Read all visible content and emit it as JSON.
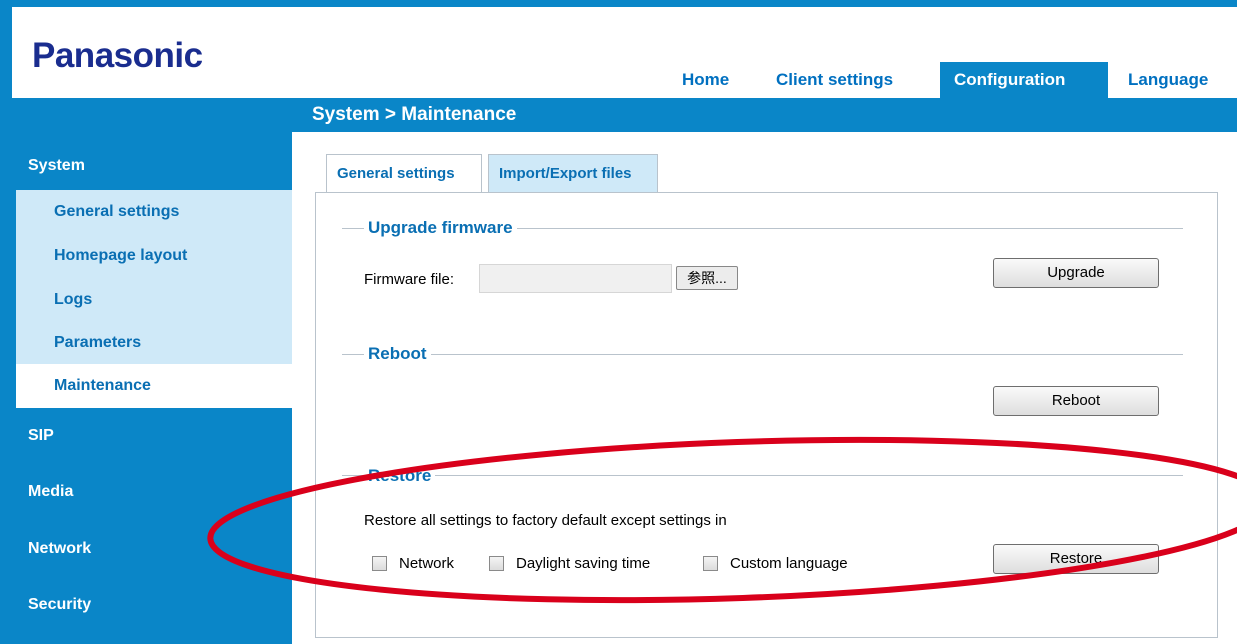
{
  "brand": {
    "logo_text": "Panasonic"
  },
  "top_nav": {
    "items": [
      {
        "label": "Home"
      },
      {
        "label": "Client settings"
      },
      {
        "label": "Configuration"
      },
      {
        "label": "Language"
      }
    ],
    "active": "Configuration"
  },
  "breadcrumb": "System  >  Maintenance",
  "sidebar": {
    "system_label": "System",
    "sub_items": [
      {
        "label": "General settings"
      },
      {
        "label": "Homepage layout"
      },
      {
        "label": "Logs"
      },
      {
        "label": "Parameters"
      },
      {
        "label": "Maintenance"
      }
    ],
    "selected_sub": "Maintenance",
    "main_items": [
      {
        "label": "SIP"
      },
      {
        "label": "Media"
      },
      {
        "label": "Network"
      },
      {
        "label": "Security"
      }
    ]
  },
  "tabs": [
    {
      "label": "General settings"
    },
    {
      "label": "Import/Export files"
    }
  ],
  "upgrade": {
    "section_title": "Upgrade firmware",
    "file_label": "Firmware file:",
    "file_value": "",
    "browse_label": "参照...",
    "button_label": "Upgrade"
  },
  "reboot": {
    "section_title": "Reboot",
    "button_label": "Reboot"
  },
  "restore": {
    "section_title": "Restore",
    "description": "Restore all settings to factory default except settings in",
    "options": [
      {
        "label": "Network",
        "checked": false
      },
      {
        "label": "Daylight saving time",
        "checked": false
      },
      {
        "label": "Custom language",
        "checked": false
      }
    ],
    "button_label": "Restore"
  },
  "colors": {
    "brand_blue": "#0a86c8",
    "logo_blue": "#1a2d8f",
    "link_blue": "#0a6fb3",
    "highlight_ellipse": "#d9001b"
  }
}
